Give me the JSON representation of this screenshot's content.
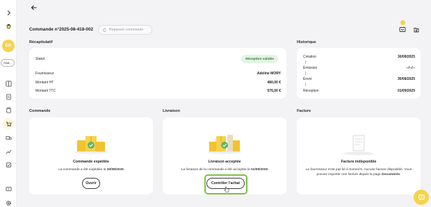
{
  "sidebar": {
    "avatar_initials": "DB",
    "account_pill": "Aaa..."
  },
  "header": {
    "title": "Commande n°2025-08-418-002",
    "reorder_label": "Repasser commande"
  },
  "sections": {
    "recap": "Récapitulatif",
    "history": "Historique",
    "order": "Commande",
    "delivery": "Livraison",
    "invoice": "Facture"
  },
  "recap": {
    "status_label": "Statut",
    "status_value": "Réception validée",
    "supplier_label": "Fournisseur",
    "supplier_value": "Adeline MORY",
    "ht_label": "Montant HT",
    "ht_value": "480,00 €",
    "ttc_label": "Montant TTC",
    "ttc_value": "576,00 €"
  },
  "history": {
    "creation_label": "Création",
    "creation_value": "30/08/2025",
    "emission_label": "Émission",
    "emission_value": "--/--/--",
    "envoi_label": "Envoi",
    "envoi_value": "30/08/2025",
    "reception_label": "Réception",
    "reception_value": "01/09/2025"
  },
  "order_card": {
    "title": "Commande expédiée",
    "desc_prefix": "La commande a été expédiée le ",
    "desc_date": "30/08/2025",
    "button": "Ouvrir"
  },
  "delivery_card": {
    "title": "Livraison acceptée",
    "desc_prefix": "La livraison de la commande a été acceptée le ",
    "desc_date": "01/09/2025",
    "button": "Contrôler l'achat"
  },
  "invoice_card": {
    "title": "Facture indisponible",
    "desc_line1": "Le fournisseur n'est pas lié à Sommi'X. Aucune facture disponible. Vous",
    "desc_line2_prefix": "pouvez importer une facture depuis la page ",
    "desc_line2_link": "Documents",
    "desc_line2_suffix": "."
  },
  "colors": {
    "accent": "#f6d34b",
    "success_bg": "#e3f4e3",
    "success_text": "#2f7a35",
    "highlight": "#7cc242"
  }
}
